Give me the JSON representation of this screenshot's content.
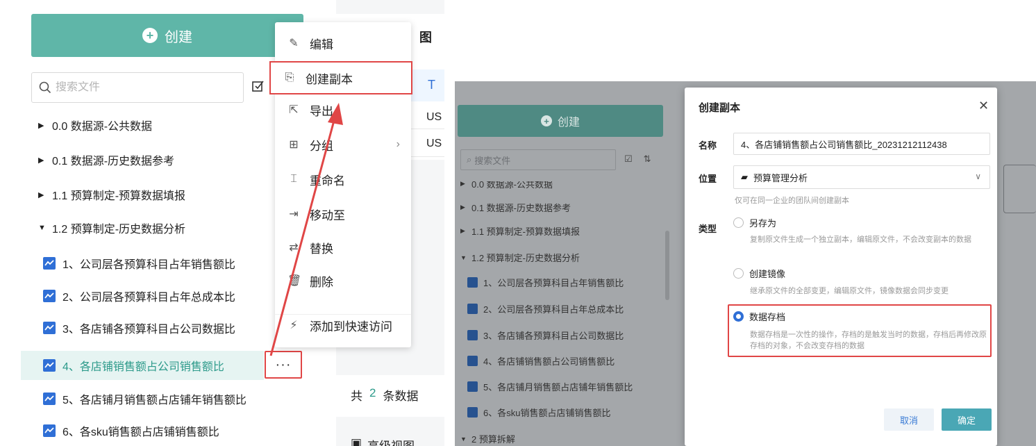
{
  "left": {
    "create_label": "创建",
    "search_placeholder": "搜索文件",
    "folders": [
      {
        "label": "0.0 数据源-公共数据",
        "expanded": false
      },
      {
        "label": "0.1 数据源-历史数据参考",
        "expanded": false
      },
      {
        "label": "1.1 预算制定-预算数据填报",
        "expanded": false
      },
      {
        "label": "1.2 预算制定-历史数据分析",
        "expanded": true
      }
    ],
    "files": [
      "1、公司层各预算科目占年销售额比",
      "2、公司层各预算科目占年总成本比",
      "3、各店铺各预算科目占公司数据比",
      "4、各店铺销售额占公司销售额比",
      "5、各店铺月销售额占店铺年销售额比",
      "6、各sku销售额占店铺销售额比"
    ],
    "active_index": 3,
    "more_label": "···",
    "table": {
      "header_char": "图",
      "th_char": "T",
      "rows": [
        "US",
        "US"
      ],
      "count_prefix": "共",
      "count_value": "2",
      "count_suffix": "条数据",
      "adv_view": "高级视图"
    },
    "context_menu": [
      {
        "label": "编辑",
        "icon": "edit-icon",
        "glyph": "✎"
      },
      {
        "label": "创建副本",
        "icon": "copy-icon",
        "glyph": "⎘"
      },
      {
        "label": "导出",
        "icon": "export-icon",
        "glyph": "⇱"
      },
      {
        "label": "分组",
        "icon": "group-icon",
        "glyph": "⊞"
      },
      {
        "label": "重命名",
        "icon": "rename-icon",
        "glyph": "⌶"
      },
      {
        "label": "移动至",
        "icon": "move-icon",
        "glyph": "⇥"
      },
      {
        "label": "替换",
        "icon": "replace-icon",
        "glyph": "⇄"
      },
      {
        "label": "删除",
        "icon": "delete-icon",
        "glyph": "🗑"
      },
      {
        "label": "添加到快速访问",
        "icon": "quick-access-icon",
        "glyph": "⚡"
      }
    ]
  },
  "right": {
    "create_label": "创建",
    "search_placeholder": "搜索文件",
    "tree_folders": [
      "0.0 数据源-公共数据",
      "0.1 数据源-历史数据参考",
      "1.1 预算制定-预算数据填报",
      "1.2 预算制定-历史数据分析"
    ],
    "tree_files": [
      "1、公司层各预算科目占年销售额比",
      "2、公司层各预算科目占年总成本比",
      "3、各店铺各预算科目占公司数据比",
      "4、各店铺销售额占公司销售额比",
      "5、各店铺月销售额占店铺年销售额比",
      "6、各sku销售额占店铺销售额比"
    ],
    "tree_tail": "2 预算拆解",
    "dialog": {
      "title": "创建副本",
      "name_label": "名称",
      "name_value": "4、各店铺销售额占公司销售额比_20231212112438",
      "location_label": "位置",
      "location_value": "预算管理分析",
      "location_hint": "仅可在同一企业的团队间创建副本",
      "type_label": "类型",
      "options": [
        {
          "label": "另存为",
          "desc": "复制原文件生成一个独立副本，编辑原文件，不会改变副本的数据",
          "selected": false
        },
        {
          "label": "创建镜像",
          "desc": "继承原文件的全部变更，编辑原文件，镜像数据会同步变更",
          "selected": false
        },
        {
          "label": "数据存档",
          "desc": "数据存档是一次性的操作，存档的是触发当时的数据，存档后再修改原存档的对象，不会改变存档的数据",
          "selected": true
        }
      ],
      "cancel_label": "取消",
      "ok_label": "确定"
    }
  },
  "colors": {
    "accent": "#5fb6a8",
    "highlight": "#e04646",
    "link": "#2f6fd6"
  }
}
